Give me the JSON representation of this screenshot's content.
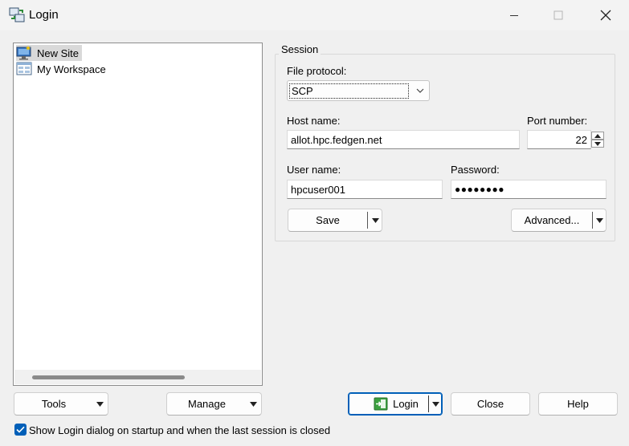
{
  "window": {
    "title": "Login",
    "app_icon": "winscp-icon",
    "minimize_icon": "minimize-icon",
    "maximize_icon": "maximize-icon",
    "close_icon": "close-icon"
  },
  "tree": {
    "items": [
      {
        "label": "New Site",
        "icon": "new-site-icon",
        "selected": true
      },
      {
        "label": "My Workspace",
        "icon": "workspace-icon",
        "selected": false
      }
    ]
  },
  "session": {
    "group_label": "Session",
    "file_protocol_label": "File protocol:",
    "file_protocol_value": "SCP",
    "host_name_label": "Host name:",
    "host_name_value": "allot.hpc.fedgen.net",
    "port_label": "Port number:",
    "port_value": "22",
    "user_name_label": "User name:",
    "user_name_value": "hpcuser001",
    "password_label": "Password:",
    "password_value": "●●●●●●●●",
    "save_label": "Save",
    "advanced_label": "Advanced..."
  },
  "buttons": {
    "tools": "Tools",
    "manage": "Manage",
    "login": "Login",
    "close": "Close",
    "help": "Help"
  },
  "startup_checkbox": {
    "label": "Show Login dialog on startup and when the last session is closed",
    "checked": true
  },
  "colors": {
    "accent": "#005fb8",
    "background": "#f0f0f0"
  }
}
